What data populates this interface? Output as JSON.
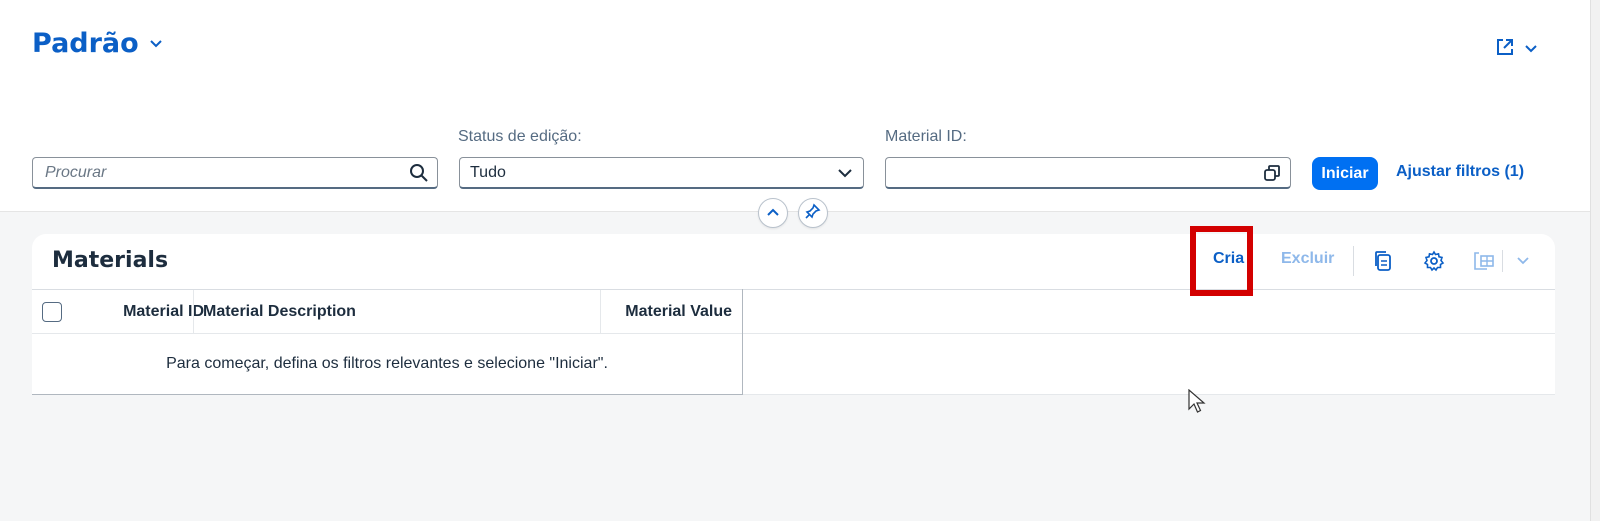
{
  "variant": {
    "title": "Padrão",
    "dropdown_icon": "chevron-down-icon"
  },
  "header_actions": {
    "share_icon": "share-icon",
    "dropdown_icon": "chevron-down-icon"
  },
  "filters": {
    "search": {
      "placeholder": "Procurar",
      "icon": "search-icon"
    },
    "status": {
      "label": "Status de edição:",
      "value": "Tudo",
      "icon": "chevron-down-icon"
    },
    "material_id": {
      "label": "Material ID:",
      "value": "",
      "icon": "value-help-icon"
    },
    "go_button": "Iniciar",
    "adapt_filters": "Ajustar filtros (1)",
    "collapse_icon": "chevron-up-icon",
    "pin_icon": "pin-icon"
  },
  "table": {
    "title": "Materials",
    "toolbar": {
      "create_label": "Cria",
      "delete_label": "Excluir",
      "copy_icon": "copy-icon",
      "settings_icon": "gear-icon",
      "export_icon": "export-icon",
      "more_icon": "chevron-down-icon"
    },
    "columns": [
      "Material ID",
      "Material Description",
      "Material Value"
    ],
    "empty_text": "Para começar, defina os filtros relevantes e selecione \"Iniciar\"."
  },
  "colors": {
    "accent": "#0070f2",
    "link": "#0b5fc6",
    "highlight": "#d30000"
  }
}
